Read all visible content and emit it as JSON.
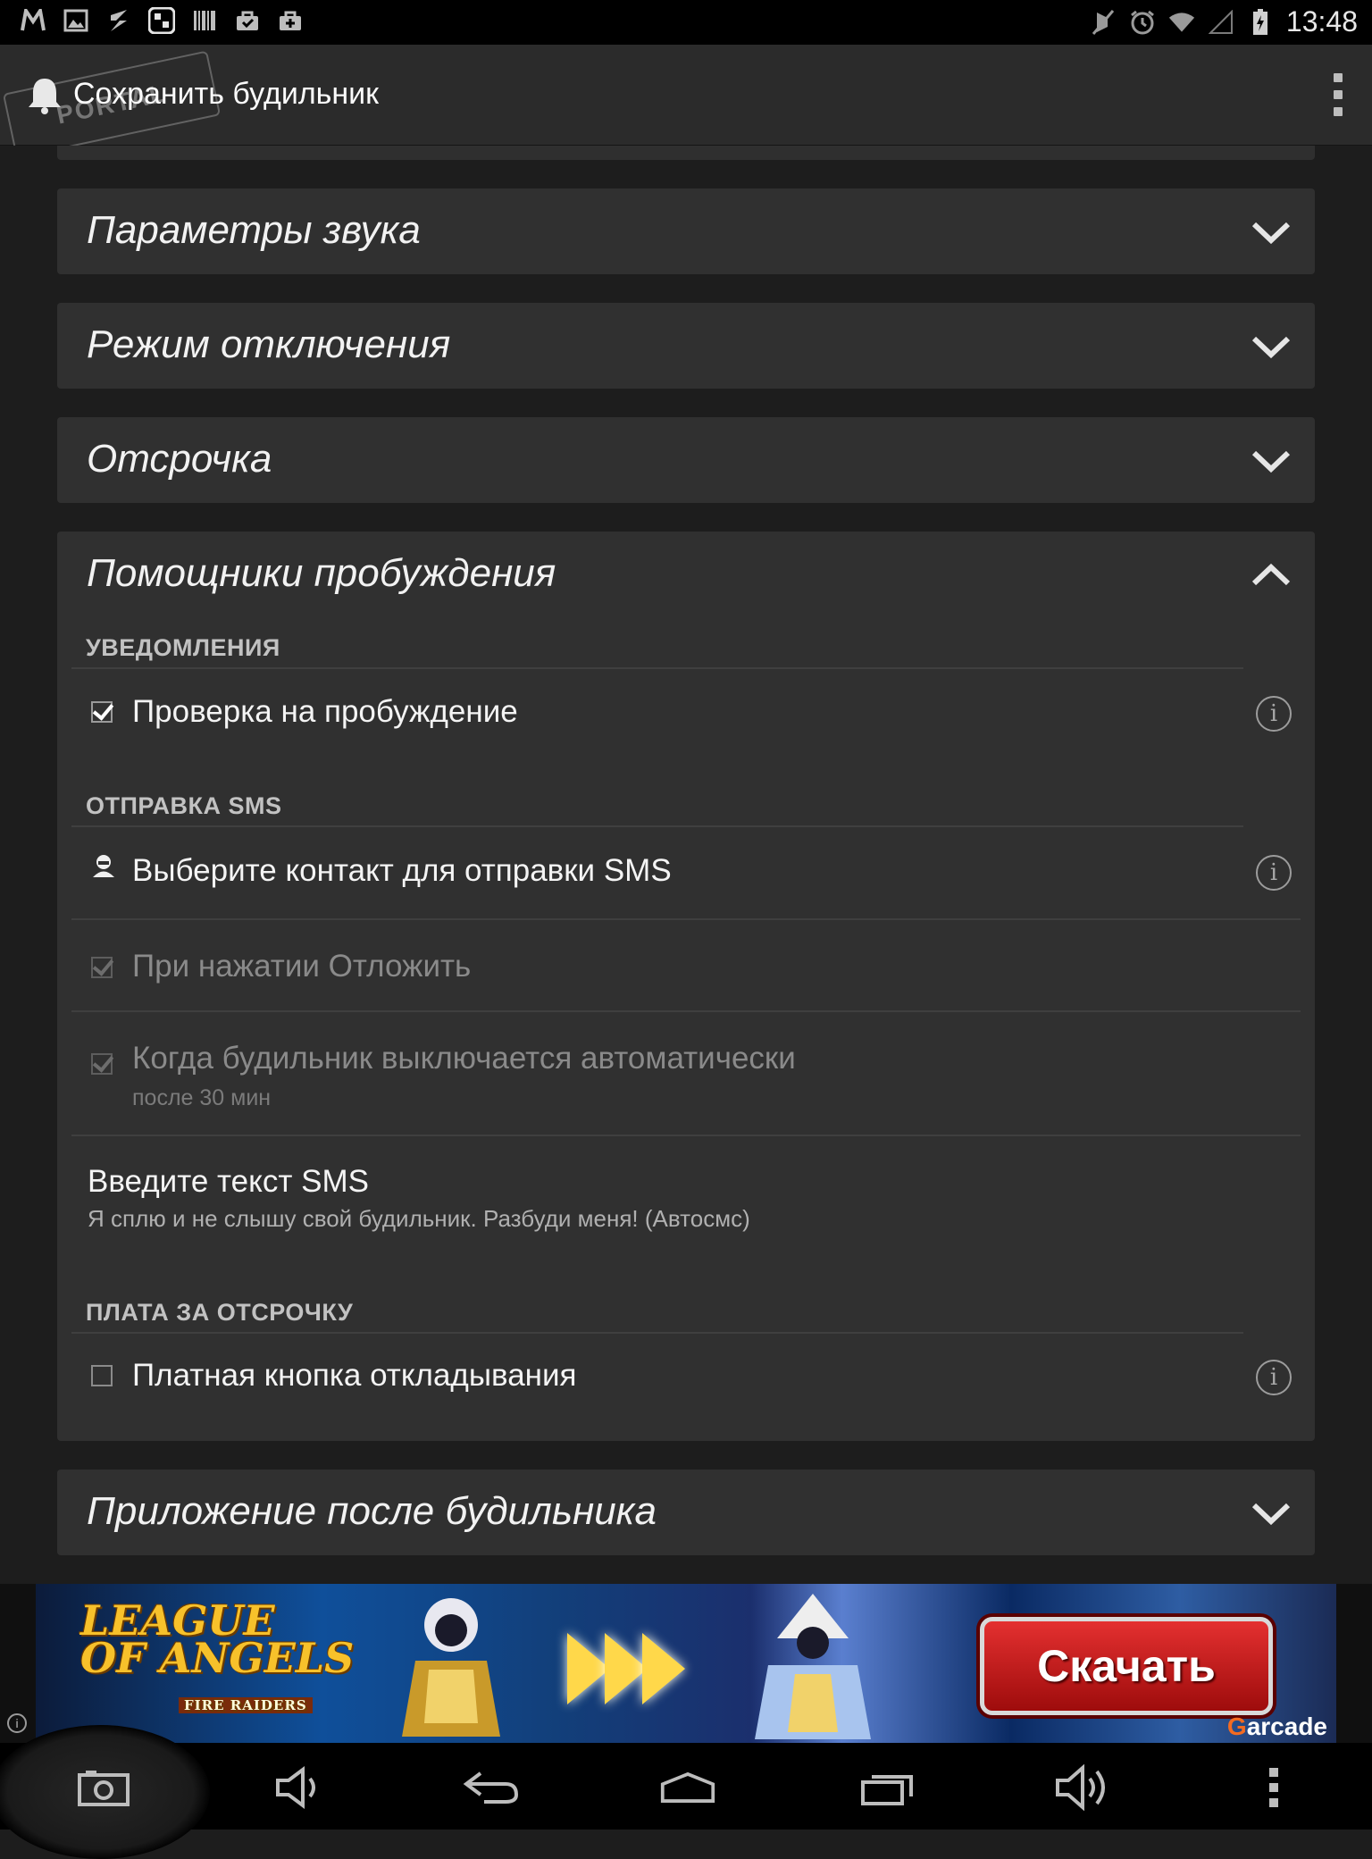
{
  "status_bar": {
    "time": "13:48",
    "left_icons": [
      "m-icon",
      "image-icon",
      "usb-icon",
      "qr-icon",
      "barcode-icon",
      "bag-check-icon",
      "bag-plus-icon"
    ],
    "right_icons": [
      "mute-icon",
      "alarm-icon",
      "wifi-icon",
      "signal-icon",
      "battery-icon"
    ]
  },
  "action_bar": {
    "title": "Сохранить будильник",
    "watermark": "PORTAL"
  },
  "sections": {
    "sound": {
      "title": "Параметры звука",
      "expanded": false
    },
    "dismiss": {
      "title": "Режим отключения",
      "expanded": false
    },
    "snooze": {
      "title": "Отсрочка",
      "expanded": false
    },
    "wake_helpers": {
      "title": "Помощники пробуждения",
      "expanded": true,
      "notifications_header": "УВЕДОМЛЕНИЯ",
      "wake_check": {
        "label": "Проверка на пробуждение",
        "checked": true
      },
      "sms_header": "ОТПРАВКА SMS",
      "choose_contact": "Выберите контакт для отправки SMS",
      "on_snooze": {
        "label": "При нажатии Отложить",
        "checked": true,
        "enabled": false
      },
      "auto_off": {
        "label": "Когда будильник выключается автоматически",
        "sub": "после 30 мин",
        "checked": true,
        "enabled": false
      },
      "sms_text": {
        "title": "Введите текст SMS",
        "value": "Я сплю и не слышу свой будильник. Разбуди меня! (Автосмс)"
      },
      "snooze_fee_header": "ПЛАТА ЗА ОТСРОЧКУ",
      "paid_snooze": {
        "label": "Платная кнопка откладывания",
        "checked": false
      }
    },
    "after_app": {
      "title": "Приложение после будильника",
      "expanded": false
    }
  },
  "ad": {
    "logo_line1": "LEAGUE",
    "logo_line2": "OF ANGELS",
    "logo_sub": "FIRE RAIDERS",
    "button": "Скачать",
    "brand_prefix": "G",
    "brand": "arcade"
  },
  "colors": {
    "background": "#1d1d1d",
    "card": "#303030",
    "action_bar": "#2b2b2b",
    "section_header": "#c2c2c2",
    "ad_button": "#c81e1e"
  }
}
